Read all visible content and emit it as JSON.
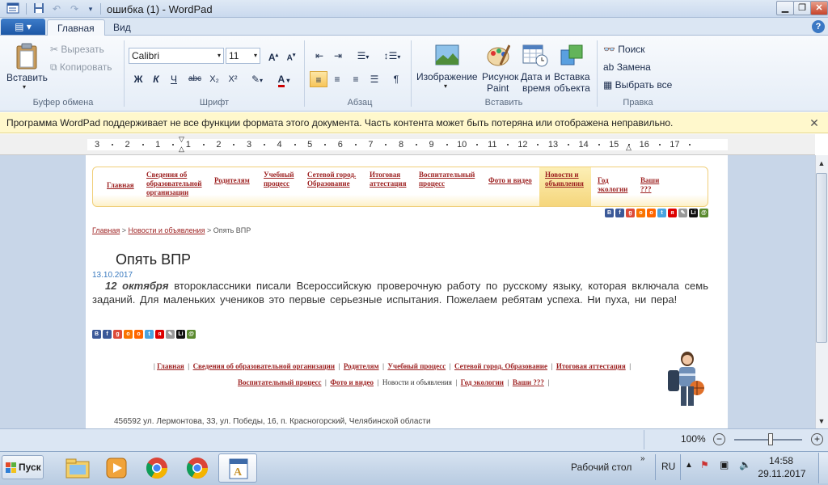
{
  "window": {
    "title": "ошибка (1) - WordPad"
  },
  "tabs": {
    "file": "",
    "home": "Главная",
    "view": "Вид"
  },
  "ribbon": {
    "clipboard": {
      "paste": "Вставить",
      "cut": "Вырезать",
      "copy": "Копировать",
      "label": "Буфер обмена"
    },
    "font": {
      "name": "Calibri",
      "size": "11",
      "bold": "Ж",
      "italic": "К",
      "underline": "Ч",
      "strike": "abc",
      "sub": "X₂",
      "sup": "X²",
      "label": "Шрифт"
    },
    "paragraph": {
      "label": "Абзац"
    },
    "insert": {
      "image": "Изображение",
      "paint_line1": "Рисунок",
      "paint_line2": "Paint",
      "date_line1": "Дата и",
      "date_line2": "время",
      "object_line1": "Вставка",
      "object_line2": "объекта",
      "label": "Вставить"
    },
    "edit": {
      "find": "Поиск",
      "replace": "Замена",
      "select_all": "Выбрать все",
      "label": "Правка"
    }
  },
  "infobar": {
    "text": "Программа WordPad поддерживает не все функции формата этого документа. Часть контента может быть потеряна или отображена неправильно."
  },
  "ruler": {
    "ticks": [
      "3",
      "2",
      "1",
      "1",
      "2",
      "3",
      "4",
      "5",
      "6",
      "7",
      "8",
      "9",
      "10",
      "11",
      "12",
      "13",
      "14",
      "15",
      "16",
      "17"
    ]
  },
  "document": {
    "nav": [
      {
        "label": "Главная"
      },
      {
        "label": "Сведения об образовательной организации"
      },
      {
        "label": "Родителям"
      },
      {
        "label": "Учебный процесс"
      },
      {
        "label": "Сетевой город. Образование"
      },
      {
        "label": "Итоговая аттестация"
      },
      {
        "label": "Воспитательный процесс"
      },
      {
        "label": "Фото и видео"
      },
      {
        "label": "Новости и объявления"
      },
      {
        "label": "Год экологии"
      },
      {
        "label": "Ваши ???"
      }
    ],
    "breadcrumb": {
      "home": "Главная",
      "sep1": " > ",
      "news": "Новости и объявления",
      "sep2": " > ",
      "current": "Опять ВПР"
    },
    "heading": "Опять ВПР",
    "date": "13.10.2017",
    "article_lead": "12 октября",
    "article_body": " второклассники писали Всероссийскую проверочную работу по русскому языку, которая включала семь заданий. Для маленьких учеников это первые серьезные испытания. Пожелаем ребятам успеха. Ни пуха, ни пера!",
    "footer_nav_row1": [
      "Главная",
      "Сведения об образовательной организации",
      "Родителям",
      "Учебный процесс",
      "Сетевой город. Образование",
      "Итоговая аттестация"
    ],
    "footer_nav_row2": [
      "Воспитательный процесс",
      "Фото и видео",
      "Новости и объявления",
      "Год экологии",
      "Ваши ???"
    ],
    "address": "456592 ул. Лермонтова, 33, ул. Победы, 16, п. Красногорский, Челябинской области"
  },
  "status": {
    "zoom": "100%"
  },
  "taskbar": {
    "start": "Пуск",
    "desktop": "Рабочий стол",
    "lang": "RU",
    "time": "14:58",
    "date": "29.11.2017"
  },
  "colors": {
    "accent": "#1d57a6",
    "link": "#9c1f1f",
    "infobar": "#fff8cc",
    "selected_nav": "#f5d67c"
  }
}
